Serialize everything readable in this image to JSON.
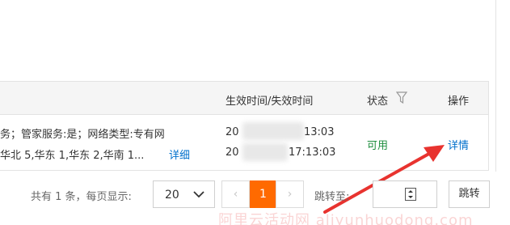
{
  "table": {
    "headers": {
      "time": "生效时间/失效时间",
      "status": "状态",
      "action": "操作"
    },
    "row": {
      "config_line1": "务；管家服务:是；网络类型:专有网",
      "config_line2": "华北 5,华东 1,华东 2,华南 1...",
      "config_more": "详细",
      "start_prefix": "20",
      "start_suffix": "13:03",
      "end_prefix": "20",
      "end_suffix": "17:13:03",
      "status": "可用",
      "action": "详情"
    }
  },
  "pager": {
    "total_text": "共有 1 条，每页显示:",
    "page_size": "20",
    "prev": "‹",
    "current_page": "1",
    "next": "›",
    "jump_label": "跳转至:",
    "jump_button": "跳转"
  },
  "watermark": "阿里云活动网 aliyunhuodong.com",
  "colors": {
    "accent": "#ff6a00",
    "link": "#0070cc",
    "ok": "#1e8e3e",
    "arrow": "#e8332f"
  }
}
